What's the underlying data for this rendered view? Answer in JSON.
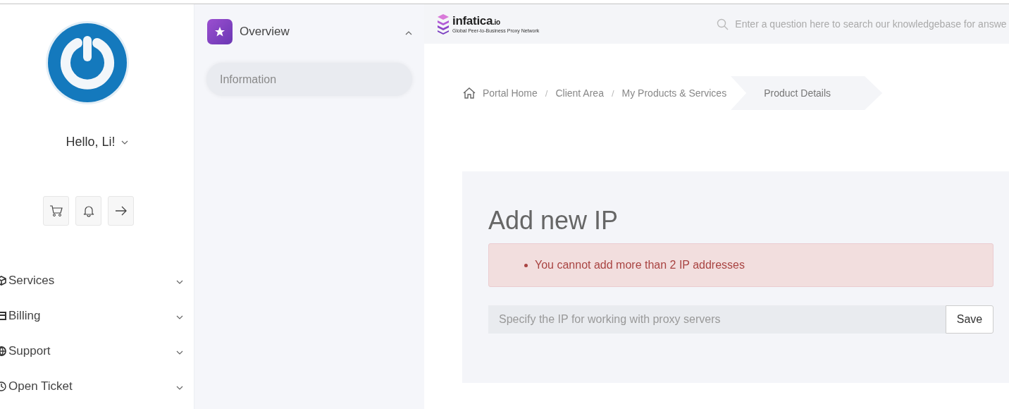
{
  "sidebar": {
    "greeting": "Hello, Li!",
    "nav": [
      {
        "label": "Services",
        "kind": "box",
        "expanded": false
      },
      {
        "label": "Billing",
        "kind": "card",
        "expanded": false
      },
      {
        "label": "Support",
        "kind": "globe",
        "expanded": false
      },
      {
        "label": "Open Ticket",
        "kind": "clock",
        "expanded": false
      }
    ]
  },
  "submenu": {
    "title": "Overview",
    "expanded": true,
    "items": [
      {
        "label": "Information",
        "selected": true
      }
    ]
  },
  "header": {
    "logo": "infatica",
    "logo_suffix": ".io",
    "tagline": "Global Peer-to-Business Proxy Network",
    "search": {
      "placeholder": "Enter a question here to search our knowledgebase for answe"
    }
  },
  "breadcrumb": [
    {
      "kind": "link",
      "label": "Portal Home",
      "active": false
    },
    {
      "kind": "separator",
      "label": "/"
    },
    {
      "kind": "link",
      "label": "Client Area",
      "active": false
    },
    {
      "kind": "separator",
      "label": "/"
    },
    {
      "kind": "link",
      "label": "My Products & Services",
      "active": false
    },
    {
      "kind": "link",
      "label": "Product Details",
      "active": true
    }
  ],
  "card": {
    "title": "Add new IP",
    "errors": [
      "You cannot add more than 2 IP addresses"
    ],
    "ip_field": {
      "placeholder": "Specify the IP for working with proxy servers"
    },
    "save_button": "Save"
  }
}
